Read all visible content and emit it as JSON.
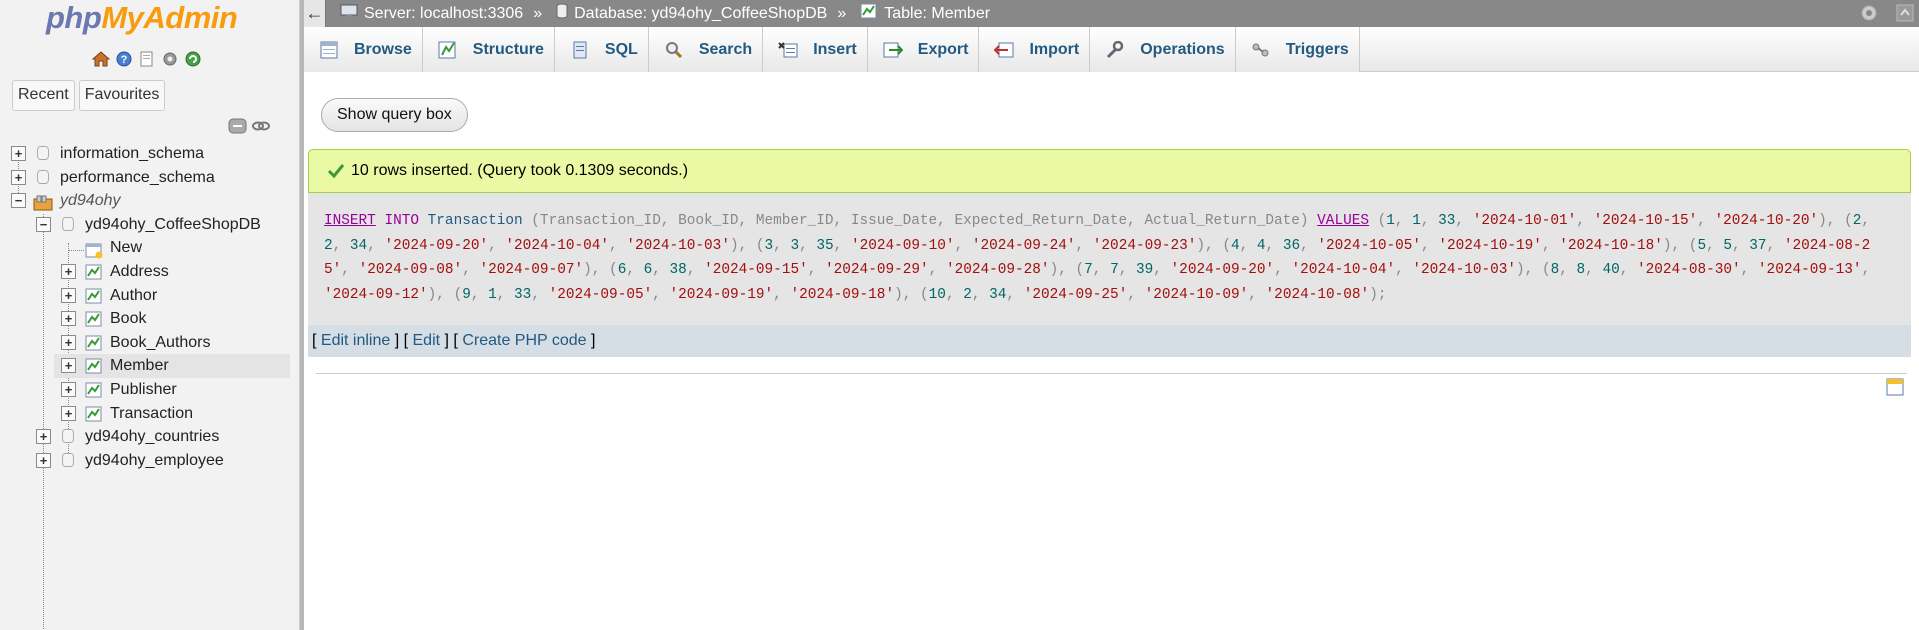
{
  "nav": {
    "logo_php": "php",
    "logo_myadmin": "MyAdmin",
    "icons": [
      "home-icon",
      "help-icon",
      "docs-icon",
      "settings-icon",
      "reload-icon"
    ],
    "tabs": {
      "recent": "Recent",
      "favourites": "Favourites"
    },
    "tree": [
      {
        "label": "information_schema",
        "type": "db"
      },
      {
        "label": "performance_schema",
        "type": "db"
      },
      {
        "label": "yd94ohy",
        "type": "group"
      },
      {
        "label": "yd94ohy_CoffeeShopDB",
        "type": "db"
      },
      {
        "label": "New",
        "type": "new"
      },
      {
        "label": "Address",
        "type": "table"
      },
      {
        "label": "Author",
        "type": "table"
      },
      {
        "label": "Book",
        "type": "table"
      },
      {
        "label": "Book_Authors",
        "type": "table"
      },
      {
        "label": "Member",
        "type": "table",
        "selected": true
      },
      {
        "label": "Publisher",
        "type": "table"
      },
      {
        "label": "Transaction",
        "type": "table"
      },
      {
        "label": "yd94ohy_countries",
        "type": "db"
      },
      {
        "label": "yd94ohy_employee",
        "type": "db"
      }
    ]
  },
  "breadcrumb": {
    "server": "Server: localhost:3306",
    "database": "Database: yd94ohy_CoffeeShopDB",
    "table": "Table: Member",
    "separator": "»"
  },
  "tabs": [
    "Browse",
    "Structure",
    "SQL",
    "Search",
    "Insert",
    "Export",
    "Import",
    "Operations",
    "Triggers"
  ],
  "content": {
    "show_query_box": "Show query box",
    "success_message": "10 rows inserted. (Query took 0.1309 seconds.)",
    "sql": {
      "kw_insert": "INSERT",
      "kw_into": "INTO",
      "table": "Transaction",
      "columns": "(Transaction_ID, Book_ID, Member_ID, Issue_Date, Expected_Return_Date, Actual_Return_Date)",
      "kw_values": "VALUES",
      "rows": [
        [
          "1",
          "1",
          "33",
          "'2024-10-01'",
          "'2024-10-15'",
          "'2024-10-20'"
        ],
        [
          "2",
          "2",
          "34",
          "'2024-09-20'",
          "'2024-10-04'",
          "'2024-10-03'"
        ],
        [
          "3",
          "3",
          "35",
          "'2024-09-10'",
          "'2024-09-24'",
          "'2024-09-23'"
        ],
        [
          "4",
          "4",
          "36",
          "'2024-10-05'",
          "'2024-10-19'",
          "'2024-10-18'"
        ],
        [
          "5",
          "5",
          "37",
          "'2024-08-25'",
          "'2024-09-08'",
          "'2024-09-07'"
        ],
        [
          "6",
          "6",
          "38",
          "'2024-09-15'",
          "'2024-09-29'",
          "'2024-09-28'"
        ],
        [
          "7",
          "7",
          "39",
          "'2024-09-20'",
          "'2024-10-04'",
          "'2024-10-03'"
        ],
        [
          "8",
          "8",
          "40",
          "'2024-08-30'",
          "'2024-09-13'",
          "'2024-09-12'"
        ],
        [
          "9",
          "1",
          "33",
          "'2024-09-05'",
          "'2024-09-19'",
          "'2024-09-18'"
        ],
        [
          "10",
          "2",
          "34",
          "'2024-09-25'",
          "'2024-10-09'",
          "'2024-10-08'"
        ]
      ]
    },
    "links": {
      "edit_inline": "Edit inline",
      "edit": "Edit",
      "create_php": "Create PHP code"
    }
  }
}
